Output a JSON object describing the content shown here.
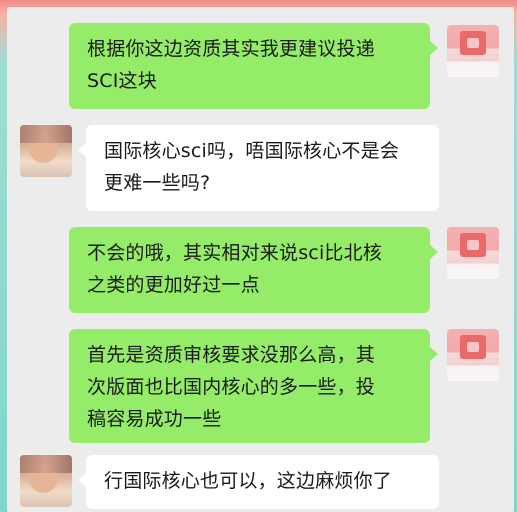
{
  "chat": {
    "messages": [
      {
        "side": "right",
        "lines": [
          "根据你这边资质其实我更建议投递",
          "SCI这块"
        ]
      },
      {
        "side": "left",
        "lines": [
          "国际核心sci吗，唔国际核心不是会",
          "更难一些吗?"
        ]
      },
      {
        "side": "right",
        "lines": [
          "不会的哦，其实相对来说sci比北核",
          "之类的更加好过一点"
        ]
      },
      {
        "side": "right",
        "lines": [
          "首先是资质审核要求没那么高，其",
          "次版面也比国内核心的多一些，投",
          "稿容易成功一些"
        ]
      },
      {
        "side": "left",
        "lines": [
          "行国际核心也可以，这边麻烦你了"
        ]
      }
    ]
  },
  "avatars": {
    "me_icon": "pink-seal-avatar",
    "other_icon": "blurred-portrait-avatar"
  },
  "colors": {
    "sent_bubble": "#95ec69",
    "received_bubble": "#ffffff",
    "chat_background": "#ececec"
  }
}
